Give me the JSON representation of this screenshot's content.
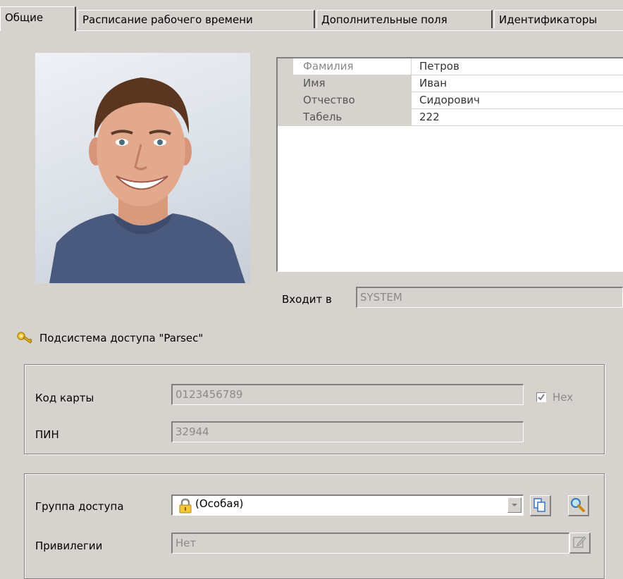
{
  "tabs": [
    {
      "label": "Общие",
      "active": true
    },
    {
      "label": "Расписание рабочего времени",
      "active": false
    },
    {
      "label": "Дополнительные поля",
      "active": false
    },
    {
      "label": "Идентификаторы",
      "active": false
    }
  ],
  "properties": [
    {
      "key": "Фамилия",
      "value": "Петров"
    },
    {
      "key": "Имя",
      "value": "Иван"
    },
    {
      "key": "Отчество",
      "value": "Сидорович"
    },
    {
      "key": "Табель",
      "value": "222"
    }
  ],
  "membership": {
    "label": "Входит в",
    "value": "SYSTEM"
  },
  "subsystem": {
    "title": "Подсистема доступа \"Parsec\"",
    "icon": "key-icon"
  },
  "card": {
    "code_label": "Код карты",
    "code_value": "0123456789",
    "hex_label": "Hex",
    "hex_checked": true,
    "pin_label": "ПИН",
    "pin_value": "32944"
  },
  "access": {
    "group_label": "Группа доступа",
    "group_value": "(Особая)",
    "group_icon": "lock-icon",
    "privileges_label": "Привилегии",
    "privileges_value": "Нет"
  },
  "colors": {
    "window_bg": "#d6d3ce",
    "shirt": "#4a5a7e",
    "disabled_text": "#8a8a8a"
  }
}
